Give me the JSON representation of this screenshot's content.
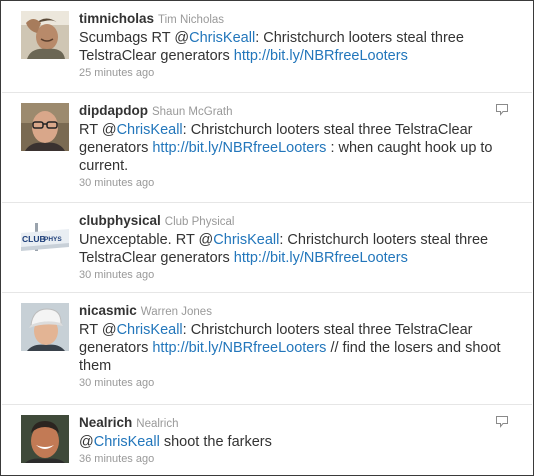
{
  "tweets": [
    {
      "screen_name": "timnicholas",
      "full_name": "Tim Nicholas",
      "pre": "Scumbags RT @",
      "mention": "ChrisKeall",
      "mid": ": Christchurch looters steal three TelstraClear generators ",
      "link": "http://bit.ly/NBRfreeLooters",
      "post": "",
      "time": "25 minutes ago"
    },
    {
      "screen_name": "dipdapdop",
      "full_name": "Shaun McGrath",
      "pre": "RT @",
      "mention": "ChrisKeall",
      "mid": ": Christchurch looters steal three TelstraClear generators ",
      "link": "http://bit.ly/NBRfreeLooters",
      "post": " : when caught hook up to current.",
      "time": "30 minutes ago"
    },
    {
      "screen_name": "clubphysical",
      "full_name": "Club Physical",
      "pre": "Unexceptable. RT @",
      "mention": "ChrisKeall",
      "mid": ": Christchurch looters steal three TelstraClear generators ",
      "link": "http://bit.ly/NBRfreeLooters",
      "post": "",
      "time": "30 minutes ago",
      "avatar_text": "CLUB PHYSICAL"
    },
    {
      "screen_name": "nicasmic",
      "full_name": "Warren Jones",
      "pre": "RT @",
      "mention": "ChrisKeall",
      "mid": ": Christchurch looters steal three TelstraClear generators ",
      "link": "http://bit.ly/NBRfreeLooters",
      "post": " // find the losers and shoot them",
      "time": "30 minutes ago"
    },
    {
      "screen_name": "Nealrich",
      "full_name": "Nealrich",
      "pre": "@",
      "mention": "ChrisKeall",
      "mid": " shoot the farkers",
      "link": "",
      "post": "",
      "time": "36 minutes ago"
    }
  ],
  "icons": {
    "reply": "speech-bubble-reply-icon"
  },
  "colors": {
    "link": "#2276bb",
    "meta": "#999999",
    "text": "#333333"
  }
}
